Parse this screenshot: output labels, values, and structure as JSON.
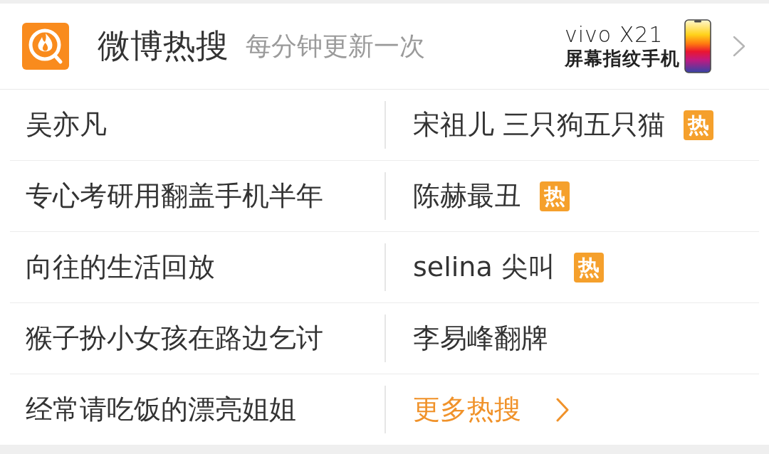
{
  "header": {
    "title": "微博热搜",
    "subtitle": "每分钟更新一次",
    "ad": {
      "headline": "vivo X21",
      "tagline": "屏幕指纹手机"
    }
  },
  "topics": [
    {
      "kind": "topic",
      "text": "吴亦凡"
    },
    {
      "kind": "topic",
      "text": "宋祖儿 三只狗五只猫",
      "badge": "热"
    },
    {
      "kind": "topic",
      "text": "专心考研用翻盖手机半年"
    },
    {
      "kind": "topic",
      "text": "陈赫最丑",
      "badge": "热"
    },
    {
      "kind": "topic",
      "text": "向往的生活回放"
    },
    {
      "kind": "topic",
      "text": "selina 尖叫",
      "badge": "热"
    },
    {
      "kind": "topic",
      "text": "猴子扮小女孩在路边乞讨"
    },
    {
      "kind": "topic",
      "text": "李易峰翻牌"
    },
    {
      "kind": "topic",
      "text": "经常请吃饭的漂亮姐姐"
    },
    {
      "kind": "more",
      "text": "更多热搜"
    }
  ]
}
